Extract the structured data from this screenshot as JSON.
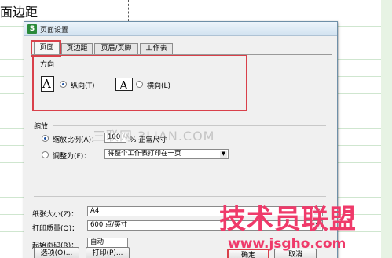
{
  "sheet": {
    "title": "面边距"
  },
  "dialog": {
    "title": "页面设置",
    "app_icon": "S",
    "tabs": [
      {
        "label": "页面",
        "active": true
      },
      {
        "label": "页边距",
        "active": false
      },
      {
        "label": "页眉/页脚",
        "active": false
      },
      {
        "label": "工作表",
        "active": false
      }
    ],
    "orientation": {
      "label": "方向",
      "portrait_icon": "A",
      "landscape_icon": "A",
      "portrait_label": "纵向(T)",
      "landscape_label": "横向(L)",
      "selected": "portrait"
    },
    "scaling": {
      "label": "缩放",
      "zoom_label": "缩放比例(A)：",
      "zoom_value": "100",
      "zoom_suffix": "% 正常尺寸",
      "fit_label": "调整为(F)：",
      "fit_option": "将整个工作表打印在一页",
      "selected": "zoom"
    },
    "paper_size": {
      "label": "纸张大小(Z)：",
      "value": "A4"
    },
    "print_quality": {
      "label": "打印质量(Q)：",
      "value": "600 点/英寸"
    },
    "first_page": {
      "label": "起始页码(R)：",
      "value": "自动"
    },
    "buttons": {
      "options": "选项(O)...",
      "print": "打印(P)...",
      "ok": "确定",
      "cancel": "取消"
    }
  },
  "watermark": "三联网 3LIAN.COM",
  "brand": {
    "name": "技术员联盟",
    "url": "www.jsgho.com"
  },
  "colors": {
    "highlight_frame": "#d9404a",
    "brand": "#ef3a6a",
    "sheet_grid": "#cfe6cf"
  }
}
